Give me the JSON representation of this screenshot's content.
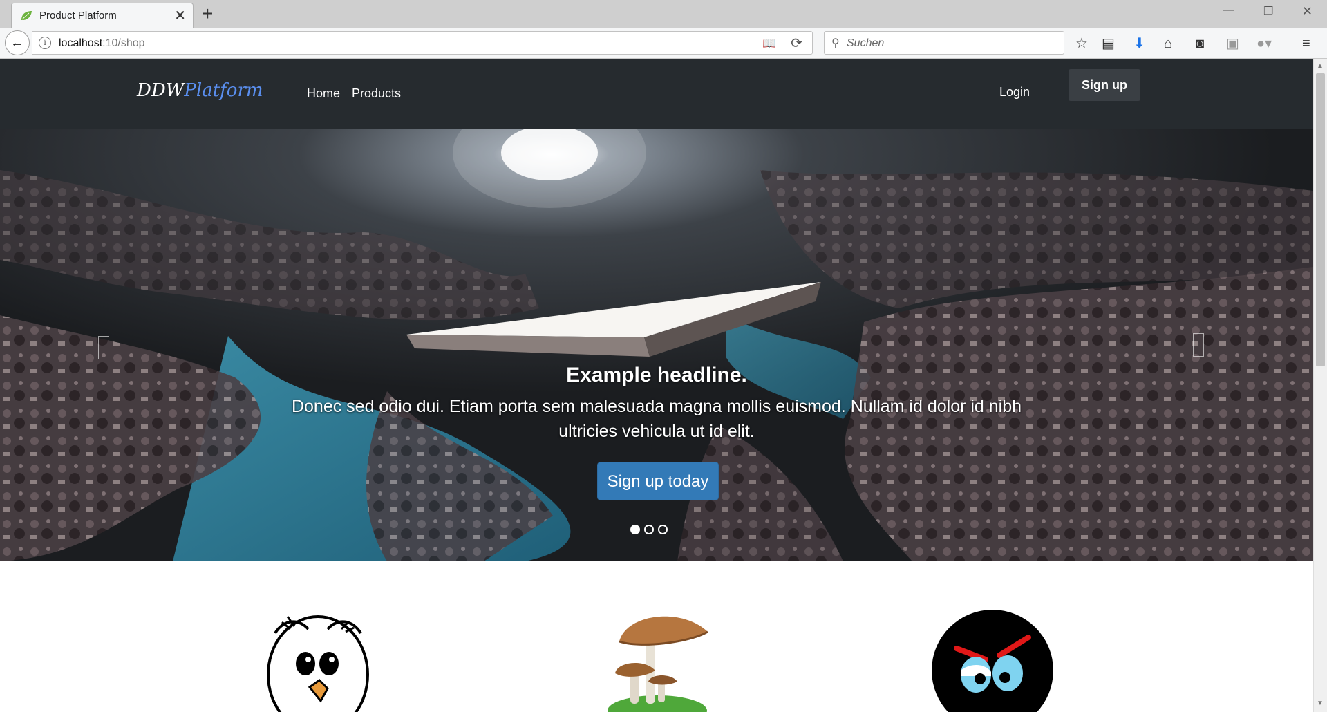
{
  "browser": {
    "tab_title": "Product Platform",
    "url_host": "localhost",
    "url_rest": ":10/shop",
    "search_placeholder": "Suchen",
    "icons": [
      "back-arrow-icon",
      "info-icon",
      "reader-view-icon",
      "reload-icon",
      "search-icon",
      "bookmark-star-icon",
      "reading-list-icon",
      "download-icon",
      "home-icon",
      "pocket-icon",
      "screenshot-icon",
      "adblock-icon",
      "menu-icon"
    ]
  },
  "site": {
    "brand_main": "DDW",
    "brand_accent": "Platform",
    "nav": [
      {
        "label": "Home"
      },
      {
        "label": "Products"
      }
    ],
    "login_label": "Login",
    "signup_label": "Sign up"
  },
  "hero": {
    "headline": "Example headline.",
    "text": "Donec sed odio dui. Etiam porta sem malesuada magna mollis euismod. Nullam id dolor id nibh ultricies vehicula ut id elit.",
    "cta_label": "Sign up today",
    "indicators": 3,
    "active_indicator": 0
  },
  "features": [
    {
      "icon": "owl-icon"
    },
    {
      "icon": "mushroom-icon"
    },
    {
      "icon": "angry-face-icon"
    }
  ],
  "colors": {
    "navbar": "#262b2f",
    "cta": "#337ab7",
    "brand_accent": "#5a8ff0"
  }
}
